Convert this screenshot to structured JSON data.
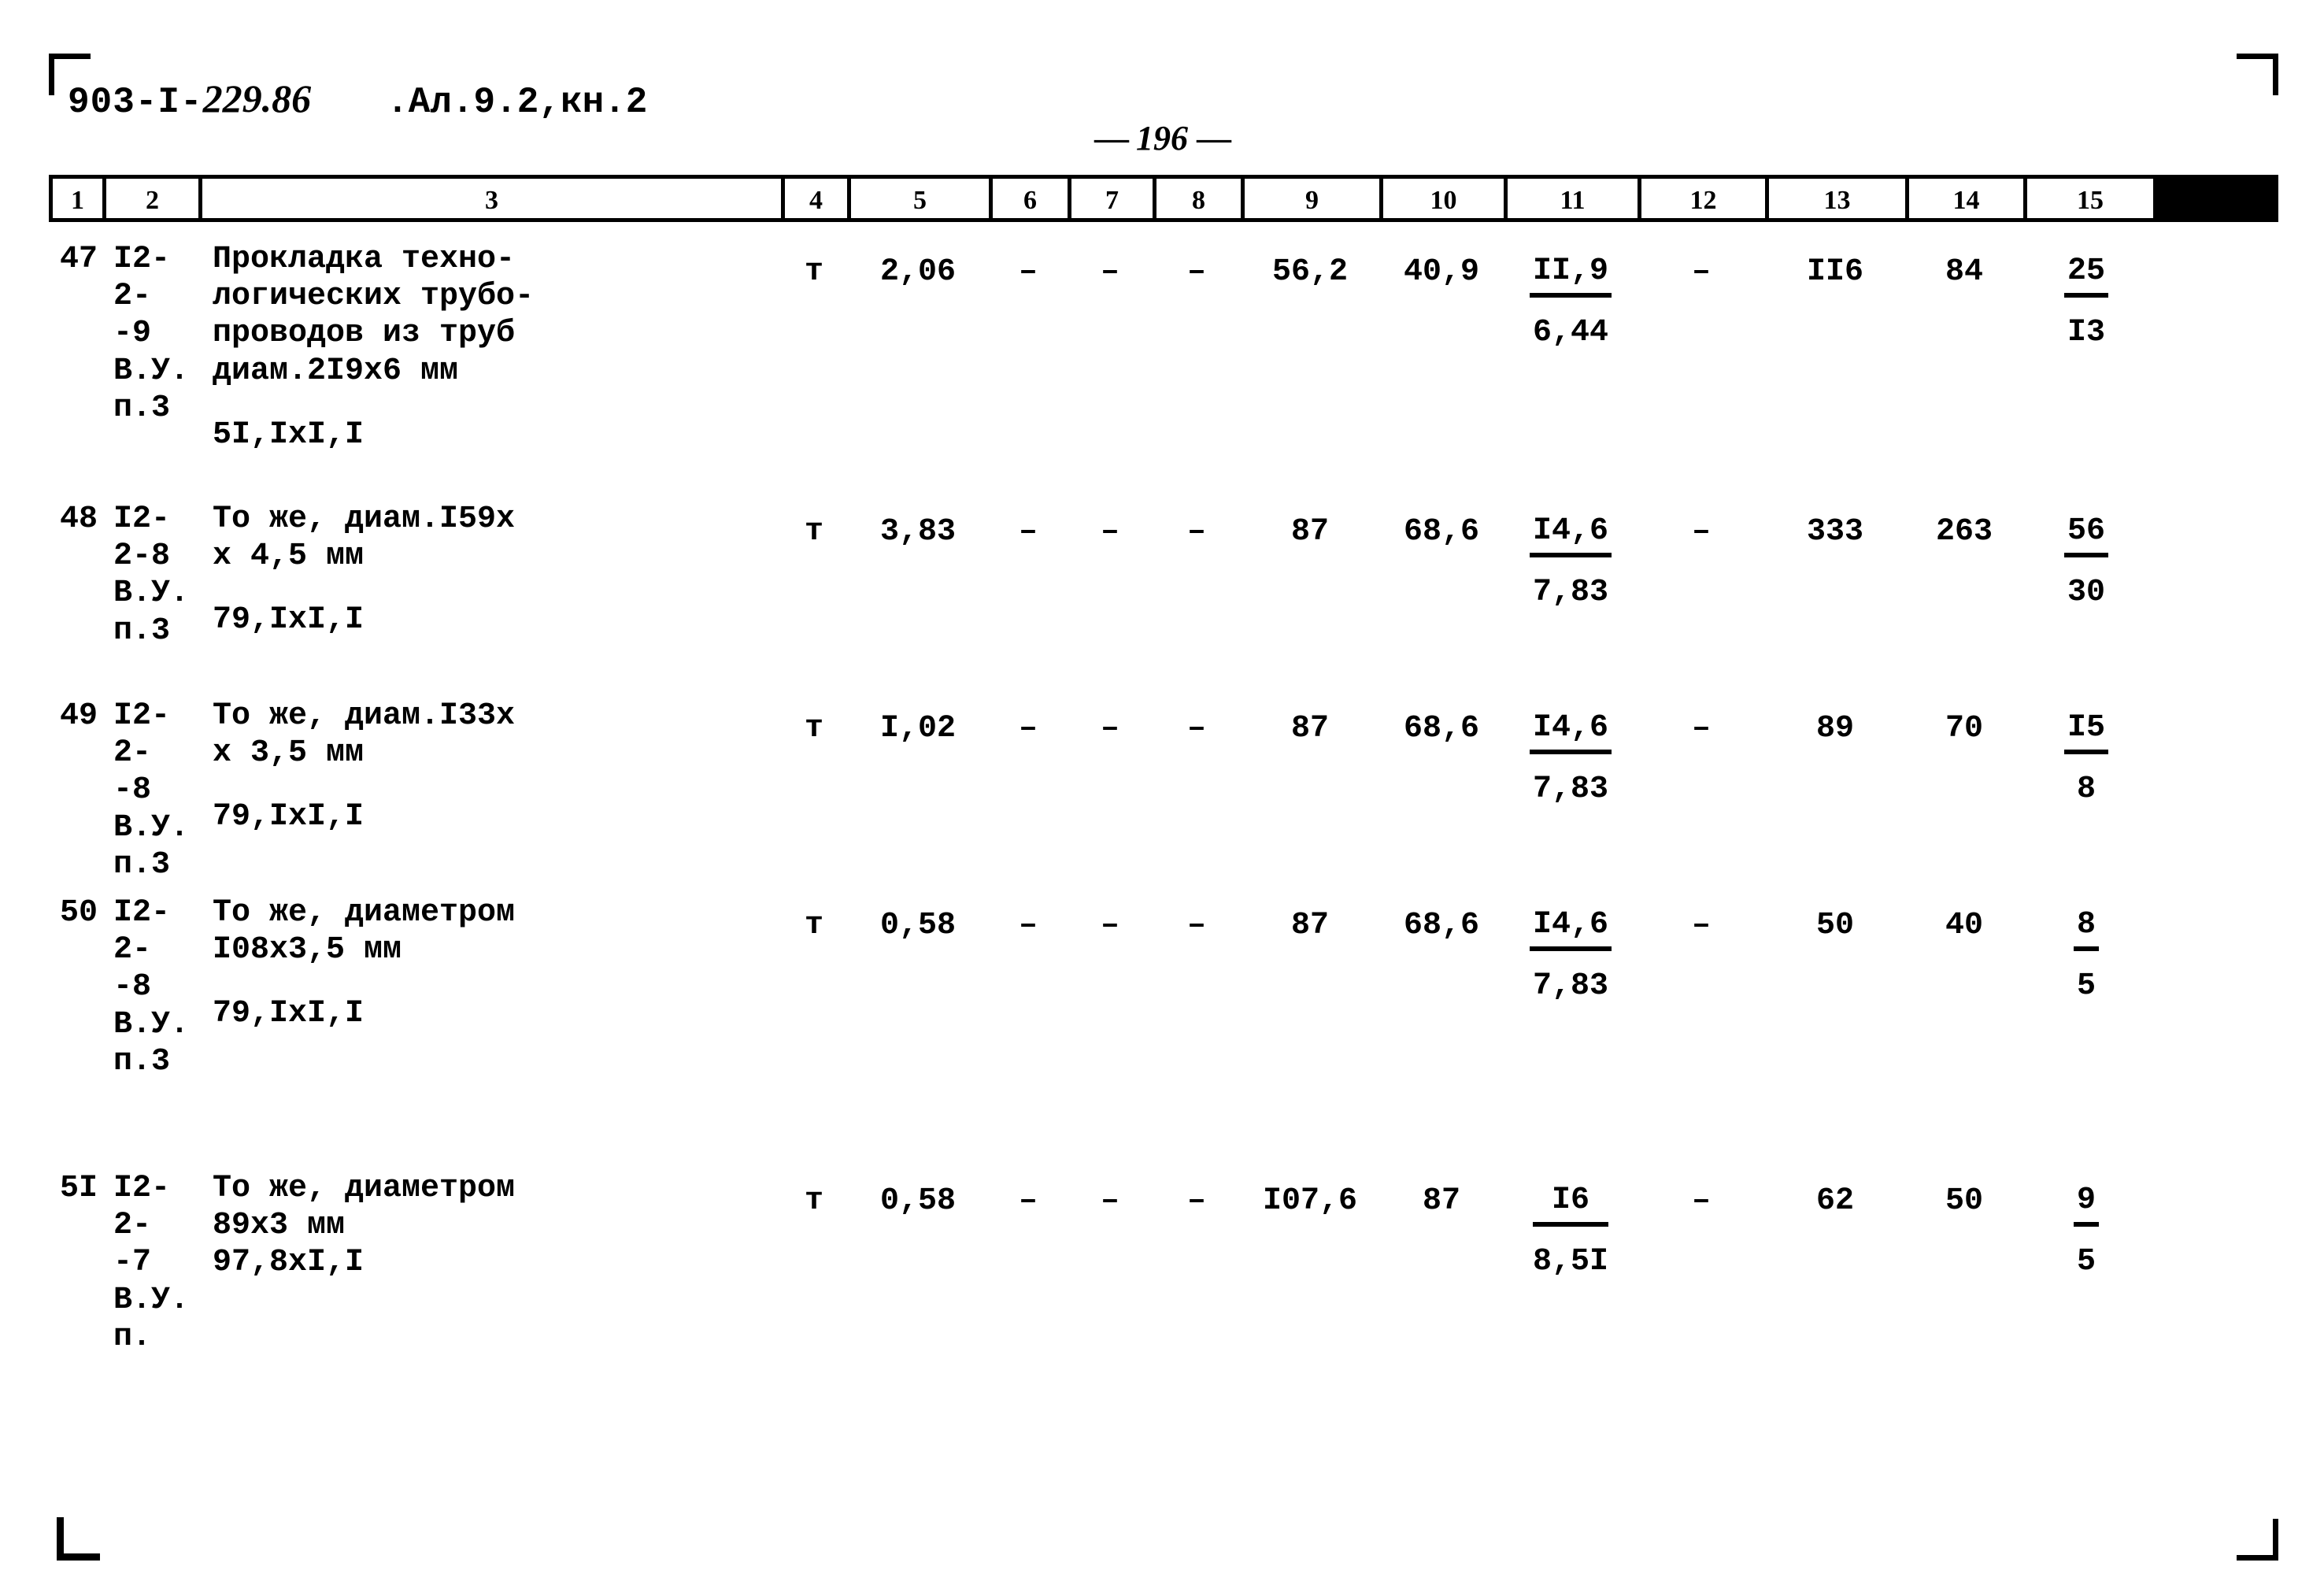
{
  "header": {
    "doc_code_prefix": "903-I-",
    "doc_code_number": "229.86",
    "album": ".Ал.9.2,кн.2"
  },
  "page": {
    "dash_left": "—",
    "number": "196",
    "dash_right": "—"
  },
  "column_headers": [
    "1",
    "2",
    "3",
    "4",
    "5",
    "6",
    "7",
    "8",
    "9",
    "10",
    "11",
    "12",
    "13",
    "14",
    "15"
  ],
  "rows": [
    {
      "num": "47",
      "code": "I2-2-\n-9\nВ.У.\nп.3",
      "desc": "Прокладка техно-\nлогических трубо-\nпроводов из труб\nдиам.2I9х6 мм",
      "desc_extra": "5I,IxI,I",
      "c4": "т",
      "c5": "2,06",
      "c6": "–",
      "c7": "–",
      "c8": "–",
      "c9": "56,2",
      "c10": "40,9",
      "c11_top": "II,9",
      "c11_bot": "6,44",
      "c12": "–",
      "c13": "II6",
      "c14": "84",
      "c15_top": "25",
      "c15_bot": "I3"
    },
    {
      "num": "48",
      "code": "I2-2-8\nВ.У.\nп.3",
      "desc": "То же, диам.I59х\nх 4,5 мм",
      "desc_extra": "79,IxI,I",
      "c4": "т",
      "c5": "3,83",
      "c6": "–",
      "c7": "–",
      "c8": "–",
      "c9": "87",
      "c10": "68,6",
      "c11_top": "I4,6",
      "c11_bot": "7,83",
      "c12": "–",
      "c13": "333",
      "c14": "263",
      "c15_top": "56",
      "c15_bot": "30"
    },
    {
      "num": "49",
      "code": "I2-2-\n-8\nВ.У.\nп.3",
      "desc": "То же, диам.I33х\nх 3,5 мм",
      "desc_extra": "79,IxI,I",
      "c4": "т",
      "c5": "I,02",
      "c6": "–",
      "c7": "–",
      "c8": "–",
      "c9": "87",
      "c10": "68,6",
      "c11_top": "I4,6",
      "c11_bot": "7,83",
      "c12": "–",
      "c13": "89",
      "c14": "70",
      "c15_top": "I5",
      "c15_bot": "8"
    },
    {
      "num": "50",
      "code": "I2-2-\n-8\nВ.У.\nп.3",
      "desc": "То же, диаметром\nI08х3,5 мм",
      "desc_extra": "79,IxI,I",
      "c4": "т",
      "c5": "0,58",
      "c6": "–",
      "c7": "–",
      "c8": "–",
      "c9": "87",
      "c10": "68,6",
      "c11_top": "I4,6",
      "c11_bot": "7,83",
      "c12": "–",
      "c13": "50",
      "c14": "40",
      "c15_top": "8",
      "c15_bot": "5"
    },
    {
      "num": "5I",
      "code": "I2-2-\n-7\nВ.У.\nп.",
      "desc": "То же, диаметром\n89х3 мм\n97,8хI,I",
      "desc_extra": "",
      "c4": "т",
      "c5": "0,58",
      "c6": "–",
      "c7": "–",
      "c8": "–",
      "c9": "I07,6",
      "c10": "87",
      "c11_top": "I6",
      "c11_bot": "8,5I",
      "c12": "–",
      "c13": "62",
      "c14": "50",
      "c15_top": "9",
      "c15_bot": "5"
    }
  ]
}
